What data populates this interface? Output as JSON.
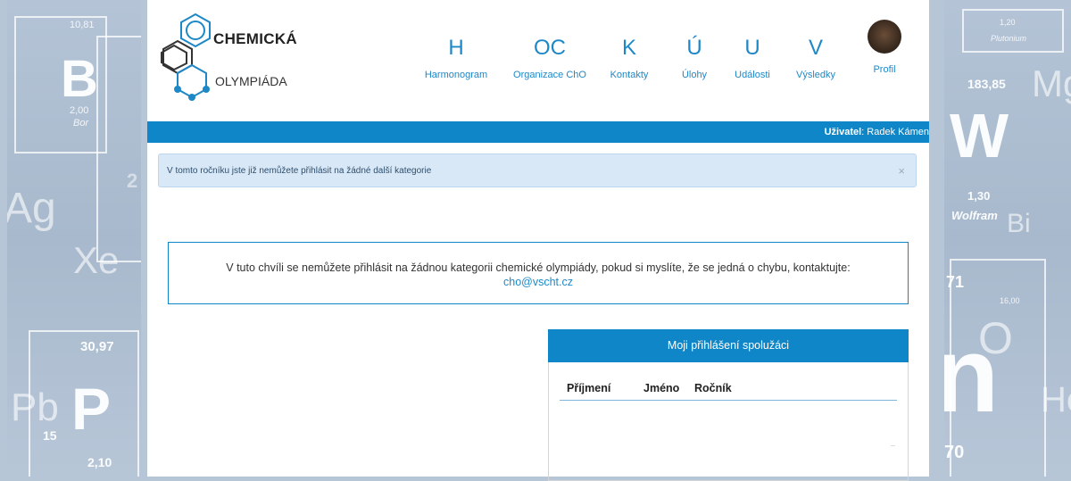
{
  "background": {
    "left": {
      "tiles": [
        {
          "num": "10,81",
          "sym": "B",
          "sub_num": "2,00",
          "sub_name": "Bor"
        },
        {
          "sym": "Ag"
        },
        {
          "sym": "Xe"
        },
        {
          "num": "30,97",
          "sym": "P",
          "pre": "Pb",
          "bottom_num": "15",
          "bottom_val": "2,10"
        }
      ],
      "edge_digit": "2"
    },
    "right": {
      "tiles": [
        {
          "num": "1,20",
          "name": "Plutonium"
        },
        {
          "num": "183,85",
          "sym": "Mg"
        },
        {
          "sym": "W",
          "num2": "1,30",
          "name": "Wolfram",
          "sym2": "Bi"
        },
        {
          "num": "71",
          "sub": "16,00"
        },
        {
          "sym": "O",
          "sym2": "n",
          "sym3": "He"
        },
        {
          "num": "70"
        }
      ]
    }
  },
  "header": {
    "logo_line1": "CHEMICKÁ",
    "logo_line2": "OLYMPIÁDA",
    "nav": [
      {
        "letter": "H",
        "label": "Harmonogram"
      },
      {
        "letter": "OC",
        "label": "Organizace ChO"
      },
      {
        "letter": "K",
        "label": "Kontakty"
      },
      {
        "letter": "Ú",
        "label": "Úlohy"
      },
      {
        "letter": "U",
        "label": "Události"
      },
      {
        "letter": "V",
        "label": "Výsledky"
      },
      {
        "letter": "",
        "label": "Profil"
      }
    ]
  },
  "userbar": {
    "label": "Uživatel",
    "name": ": Radek Kámen"
  },
  "alert": {
    "text": "V tomto ročníku jste již nemůžete přihlásit na žádné další kategorie",
    "close": "×"
  },
  "notice": {
    "text": "V tuto chvíli se nemůžete přihlásit na žádnou kategorii chemické olympiády, pokud si myslíte, že se jedná o chybu, kontaktujte:",
    "email": "cho@vscht.cz"
  },
  "classmates": {
    "title": "Moji přihlášení spolužáci",
    "columns": [
      "Příjmení",
      "Jméno",
      "Ročník"
    ]
  },
  "colors": {
    "accent": "#0e86c8",
    "link": "#1e88c7",
    "alert_bg": "#d9e8f6"
  }
}
